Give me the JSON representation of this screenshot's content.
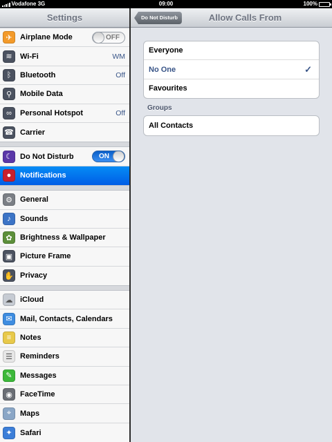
{
  "status": {
    "carrier": "Vodafone 3G",
    "time": "09:00",
    "battery": "100%"
  },
  "master": {
    "title": "Settings",
    "groups": [
      [
        {
          "label": "Airplane Mode",
          "icon": "airplane-icon",
          "color": "#f39a2a",
          "toggle": "OFF"
        },
        {
          "label": "Wi-Fi",
          "icon": "wifi-icon",
          "color": "#4b5260",
          "value": "WM"
        },
        {
          "label": "Bluetooth",
          "icon": "bluetooth-icon",
          "color": "#4b5260",
          "value": "Off"
        },
        {
          "label": "Mobile Data",
          "icon": "antenna-icon",
          "color": "#4b5260"
        },
        {
          "label": "Personal Hotspot",
          "icon": "hotspot-icon",
          "color": "#4b5260",
          "value": "Off"
        },
        {
          "label": "Carrier",
          "icon": "phone-icon",
          "color": "#4b5260"
        }
      ],
      [
        {
          "label": "Do Not Disturb",
          "icon": "moon-icon",
          "color": "#5a37a8",
          "toggle": "ON"
        },
        {
          "label": "Notifications",
          "icon": "notifications-icon",
          "color": "#c8202d",
          "selected": true
        }
      ],
      [
        {
          "label": "General",
          "icon": "gear-icon",
          "color": "#7b7f85"
        },
        {
          "label": "Sounds",
          "icon": "speaker-icon",
          "color": "#3c74c6"
        },
        {
          "label": "Brightness & Wallpaper",
          "icon": "flower-icon",
          "color": "#5c8f3a"
        },
        {
          "label": "Picture Frame",
          "icon": "picture-frame-icon",
          "color": "#4b5260"
        },
        {
          "label": "Privacy",
          "icon": "hand-icon",
          "color": "#4b5260"
        }
      ],
      [
        {
          "label": "iCloud",
          "icon": "cloud-icon",
          "color": "#c6cbd3"
        },
        {
          "label": "Mail, Contacts, Calendars",
          "icon": "mail-icon",
          "color": "#3f8de0"
        },
        {
          "label": "Notes",
          "icon": "notes-icon",
          "color": "#e8c94a"
        },
        {
          "label": "Reminders",
          "icon": "reminders-icon",
          "color": "#e7e7e7"
        },
        {
          "label": "Messages",
          "icon": "messages-icon",
          "color": "#3cb83a"
        },
        {
          "label": "FaceTime",
          "icon": "facetime-icon",
          "color": "#6a6e75"
        },
        {
          "label": "Maps",
          "icon": "maps-icon",
          "color": "#8aa6c6"
        },
        {
          "label": "Safari",
          "icon": "compass-icon",
          "color": "#3c7ed8"
        }
      ]
    ]
  },
  "detail": {
    "back_label": "Do Not Disturb",
    "title": "Allow Calls From",
    "options": [
      {
        "label": "Everyone",
        "checked": false
      },
      {
        "label": "No One",
        "checked": true
      },
      {
        "label": "Favourites",
        "checked": false
      }
    ],
    "groups_header": "Groups",
    "groups": [
      {
        "label": "All Contacts"
      }
    ]
  },
  "colors": {
    "selected_blue": "#0a6ff0",
    "toggle_on": "#1f73dd",
    "value_blue": "#385487"
  }
}
